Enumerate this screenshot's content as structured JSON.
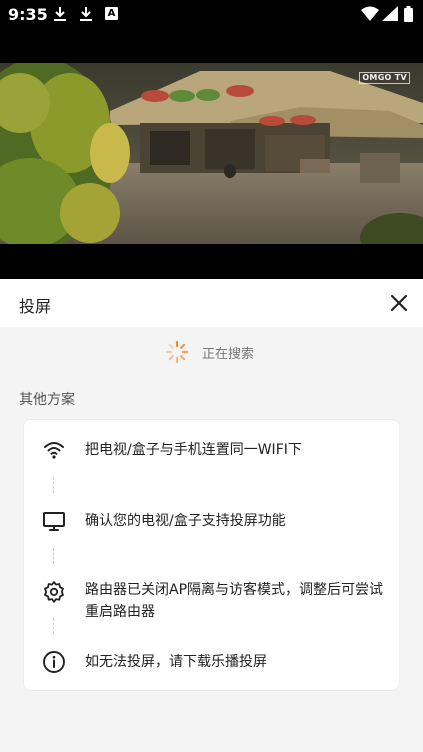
{
  "status_bar": {
    "time": "9:35",
    "a_icon_label": "A",
    "icons": [
      "download-icon",
      "download-icon",
      "a-notification-icon",
      "wifi-icon",
      "signal-icon",
      "battery-icon"
    ]
  },
  "video": {
    "watermark": "OMGO TV"
  },
  "sheet": {
    "title": "投屏",
    "close_icon": "close-icon",
    "searching_text": "正在搜索",
    "section_title": "其他方案",
    "steps": [
      {
        "icon": "wifi-icon",
        "text": "把电视/盒子与手机连置同一WIFI下"
      },
      {
        "icon": "tv-monitor-icon",
        "text": "确认您的电视/盒子支持投屏功能"
      },
      {
        "icon": "gear-icon",
        "text": "路由器已关闭AP隔离与访客模式，调整后可尝试重启路由器"
      },
      {
        "icon": "info-icon",
        "text": "如无法投屏，请下载乐播投屏"
      }
    ]
  },
  "colors": {
    "sheet_bg": "#f4f4f5",
    "spinner": "#f08a3c",
    "text_primary": "#222222",
    "text_secondary": "#777777"
  }
}
